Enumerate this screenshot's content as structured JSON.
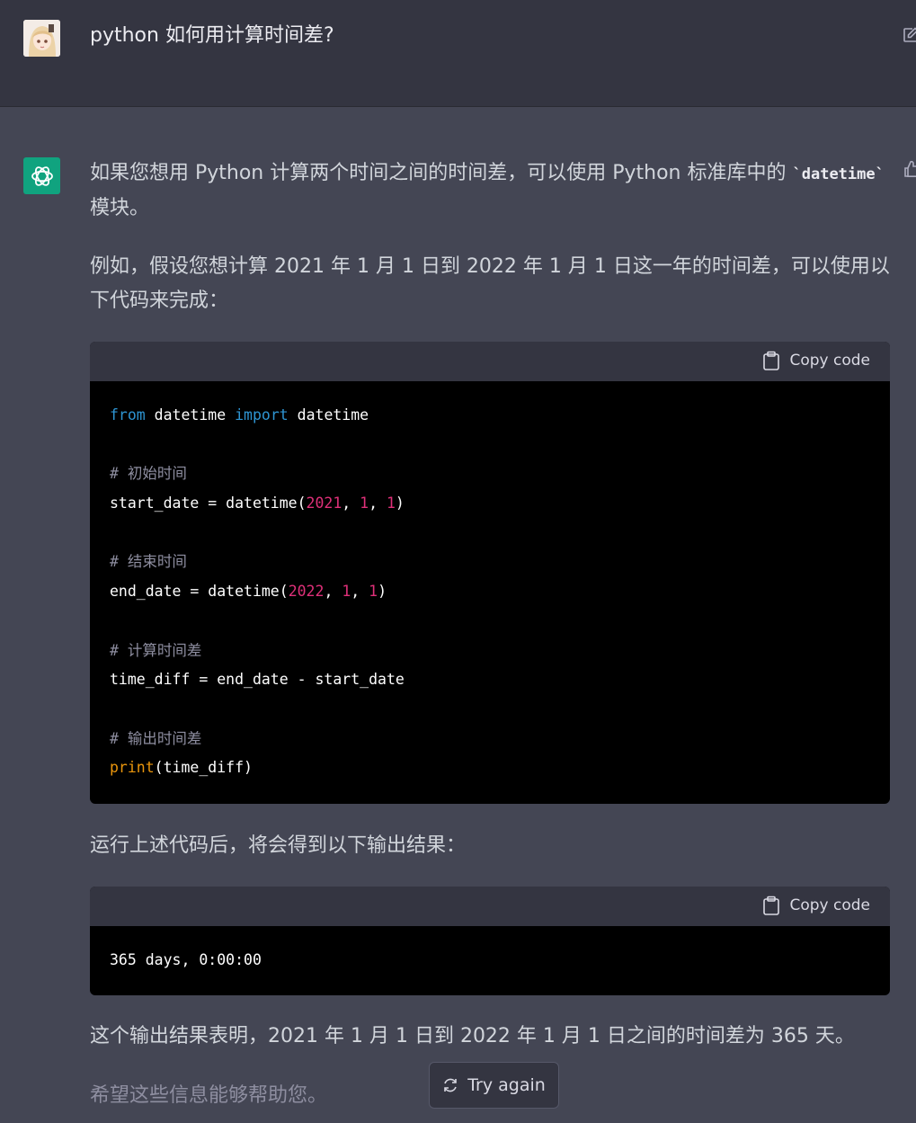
{
  "user": {
    "question": "python 如何用计算时间差?"
  },
  "assistant": {
    "p1_a": "如果您想用 Python 计算两个时间之间的时间差，可以使用 Python 标准库中的 ",
    "p1_code": "`datetime`",
    "p1_b": "模块。",
    "p2": "例如，假设您想计算 2021 年 1 月 1 日到 2022 年 1 月 1 日这一年的时间差，可以使用以下代码来完成：",
    "copy_label": "Copy code",
    "code1": {
      "l1_kw1": "from",
      "l1_t1": " datetime ",
      "l1_kw2": "import",
      "l1_t2": " datetime",
      "l3": "# 初始时间",
      "l4_a": "start_date = datetime(",
      "l4_n1": "2021",
      "l4_s1": ", ",
      "l4_n2": "1",
      "l4_s2": ", ",
      "l4_n3": "1",
      "l4_e": ")",
      "l6": "# 结束时间",
      "l7_a": "end_date = datetime(",
      "l7_n1": "2022",
      "l7_s1": ", ",
      "l7_n2": "1",
      "l7_s2": ", ",
      "l7_n3": "1",
      "l7_e": ")",
      "l9": "# 计算时间差",
      "l10": "time_diff = end_date - start_date",
      "l12": "# 输出时间差",
      "l13_fn": "print",
      "l13_rest": "(time_diff)"
    },
    "p3": "运行上述代码后，将会得到以下输出结果：",
    "code2": "365 days, 0:00:00",
    "p4": "这个输出结果表明，2021 年 1 月 1 日到 2022 年 1 月 1 日之间的时间差为 365 天。",
    "p5": "希望这些信息能够帮助您。"
  },
  "try_again_label": "Try again",
  "colors": {
    "user_bg": "#343541",
    "assistant_bg": "#444654",
    "gpt_green": "#10a37f",
    "keyword": "#2e95d3",
    "number": "#df3079",
    "builtin": "#e9950c",
    "comment": "#8e8ea0"
  }
}
